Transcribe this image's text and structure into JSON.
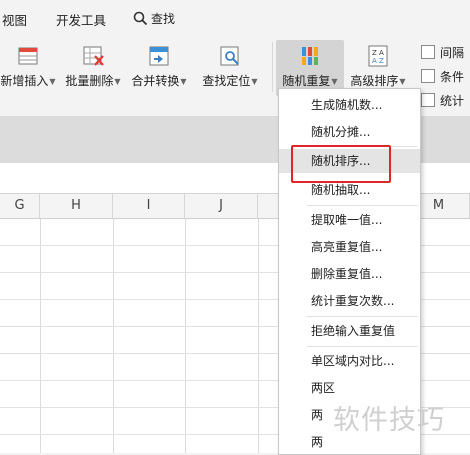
{
  "menubar": {
    "view": "视图",
    "developer": "开发工具",
    "search": "查找"
  },
  "ribbon": {
    "insert_label": "新增插入",
    "batch_delete_label": "批量删除",
    "merge_convert_label": "合并转换",
    "find_locate_label": "查找定位",
    "random_repeat_label": "随机重复",
    "advanced_sort_label": "高级排序",
    "interval_label": "间隔",
    "condition_label": "条件",
    "stats_label": "统计"
  },
  "columns": [
    "G",
    "H",
    "I",
    "J",
    "M"
  ],
  "dropdown": {
    "items": [
      "生成随机数...",
      "随机分摊...",
      "随机排序...",
      "随机抽取...",
      "提取唯一值...",
      "高亮重复值...",
      "删除重复值...",
      "统计重复次数...",
      "拒绝输入重复值",
      "单区域内对比...",
      "两区",
      "两",
      "两"
    ]
  },
  "watermark": "软件技巧",
  "colors": {
    "highlight_box": "#e0262a",
    "ribbon_active": "#d4d4d4"
  }
}
